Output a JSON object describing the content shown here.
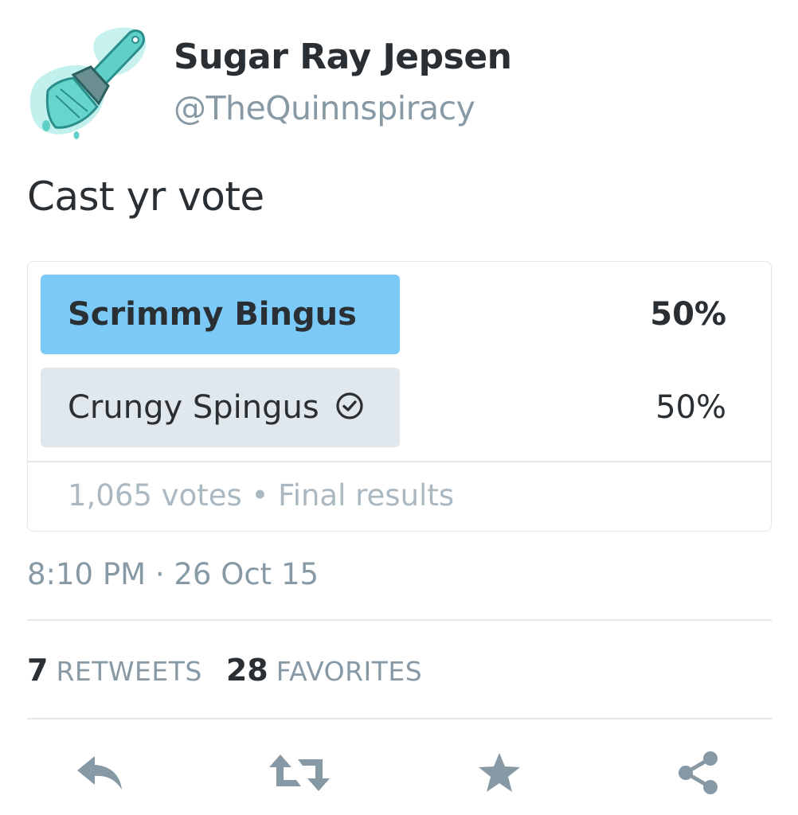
{
  "author": {
    "display_name": "Sugar Ray Jepsen",
    "handle": "@TheQuinnspiracy",
    "avatar": "teal-paintbrush-avatar"
  },
  "tweet": {
    "text": "Cast yr vote"
  },
  "poll": {
    "choices": [
      {
        "label": "Scrimmy Bingus",
        "percent": "50%",
        "fill_fraction": 0.5,
        "winner": true,
        "bar_color": "#7ac9f6"
      },
      {
        "label": "Crungy Spingus",
        "percent": "50%",
        "fill_fraction": 0.5,
        "winner": false,
        "voted_icon": "check-circle-icon",
        "bar_color": "#e1e8ed"
      }
    ],
    "footer": "1,065 votes • Final results"
  },
  "timestamp": "8:10 PM · 26 Oct 15",
  "stats": {
    "retweets": {
      "count": "7",
      "label": "RETWEETS"
    },
    "favorites": {
      "count": "28",
      "label": "FAVORITES"
    }
  },
  "actions": {
    "reply": "reply-icon",
    "retweet": "retweet-icon",
    "favorite": "star-icon",
    "share": "share-icon"
  },
  "colors": {
    "text": "#292f33",
    "secondary": "#8899a6",
    "muted": "#aab8c2",
    "border": "#e1e8ed",
    "poll_leader": "#7ac9f6",
    "icon": "#8899a6"
  }
}
